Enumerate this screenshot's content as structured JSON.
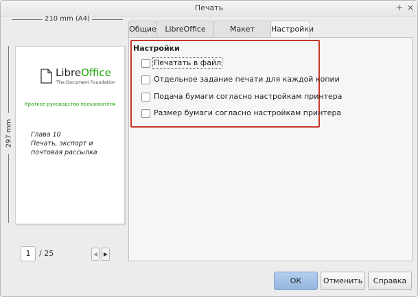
{
  "window": {
    "title": "Печать",
    "buttons": {
      "minimize": "+",
      "close": "×"
    }
  },
  "preview": {
    "width_label": "210 mm (A4)",
    "height_label": "297 mm",
    "logo": {
      "brand_prefix": "Libre",
      "brand_suffix": "Office",
      "subtitle": "The Document Foundation"
    },
    "guide_title": "Краткое руководство пользователя",
    "chapter_lines": [
      "Глава 10",
      "Печать, экспорт и",
      "почтовая рассылка"
    ],
    "page_current": "1",
    "page_total": "/ 25"
  },
  "tabs": [
    {
      "label": "Общие",
      "active": false
    },
    {
      "label": "LibreOffice Writer",
      "active": false
    },
    {
      "label": "Макет страницы",
      "active": false
    },
    {
      "label": "Настройки",
      "active": true
    }
  ],
  "settings": {
    "section_title": "Настройки",
    "options": [
      {
        "label": "Печатать в файл",
        "checked": false,
        "focused": true
      },
      {
        "label": "Отдельное задание печати для каждой копии",
        "checked": false,
        "focused": false
      },
      {
        "label": "Подача бумаги согласно настройкам принтера",
        "checked": false,
        "focused": false
      },
      {
        "label": "Размер бумаги согласно настройкам принтера",
        "checked": false,
        "focused": false
      }
    ],
    "highlight_color": "#c8372a"
  },
  "buttons": {
    "ok": "ОК",
    "cancel": "Отменить",
    "help": "Справка"
  },
  "colors": {
    "brand_green": "#18a303",
    "primary_button": "#a4c2e8"
  },
  "icons": {
    "prev": "chevron-left-icon",
    "next": "chevron-right-icon",
    "logo": "libreoffice-logo-icon"
  }
}
